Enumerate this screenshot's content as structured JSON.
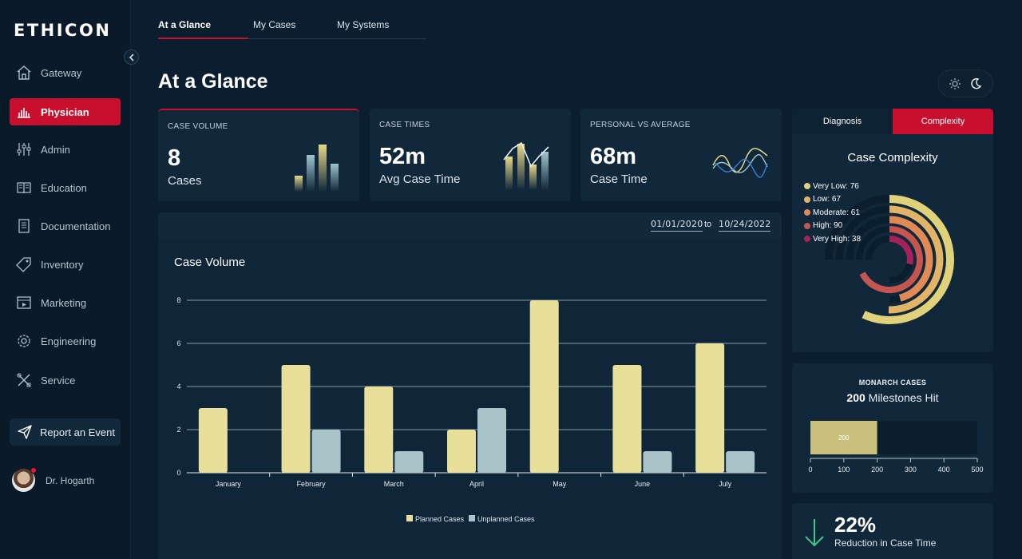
{
  "brand": "ETHICON",
  "sidebar": {
    "collapse_icon": "chevron-left-icon",
    "items": [
      {
        "label": "Gateway",
        "icon": "home-icon"
      },
      {
        "label": "Physician",
        "icon": "bar-chart-icon",
        "active": true
      },
      {
        "label": "Admin",
        "icon": "sliders-icon"
      },
      {
        "label": "Education",
        "icon": "book-icon"
      },
      {
        "label": "Documentation",
        "icon": "document-icon"
      },
      {
        "label": "Inventory",
        "icon": "tag-icon"
      },
      {
        "label": "Marketing",
        "icon": "video-icon"
      },
      {
        "label": "Engineering",
        "icon": "gear-icon"
      },
      {
        "label": "Service",
        "icon": "tools-icon"
      }
    ],
    "report_label": "Report an Event",
    "user_name": "Dr. Hogarth"
  },
  "tabs": [
    {
      "label": "At a Glance",
      "active": true
    },
    {
      "label": "My Cases"
    },
    {
      "label": "My Systems"
    }
  ],
  "page_title": "At a Glance",
  "theme_toggle": {
    "light_icon": "sun-icon",
    "dark_icon": "moon-icon",
    "selected": "dark"
  },
  "kpis": [
    {
      "label": "CASE VOLUME",
      "value": "8",
      "sub": "Cases"
    },
    {
      "label": "CASE TIMES",
      "value": "52m",
      "sub": "Avg Case Time"
    },
    {
      "label": "PERSONAL VS AVERAGE",
      "value": "68m",
      "sub": "Case Time"
    }
  ],
  "date_range": {
    "from": "01/01/2020",
    "separator": "to",
    "to": "10/24/2022"
  },
  "chart_data": {
    "type": "bar",
    "title": "Case Volume",
    "categories": [
      "January",
      "February",
      "March",
      "April",
      "May",
      "June",
      "July"
    ],
    "series": [
      {
        "name": "Planned Cases",
        "values": [
          3,
          5,
          4,
          2,
          8,
          5,
          6
        ],
        "color": "#e8e09a"
      },
      {
        "name": "Unplanned Cases",
        "values": [
          0,
          2,
          1,
          3,
          0,
          1,
          1
        ],
        "color": "#a9c4c9"
      }
    ],
    "yticks": [
      0,
      2,
      4,
      6,
      8
    ],
    "ylim": [
      0,
      8
    ],
    "grid": true,
    "legend": "bottom-center"
  },
  "complexity": {
    "tabs": [
      {
        "label": "Diagnosis"
      },
      {
        "label": "Complexity",
        "active": true
      }
    ],
    "title": "Case Complexity",
    "items": [
      {
        "label": "Very Low: 76",
        "value": 76,
        "color": "#e0d27a"
      },
      {
        "label": "Low: 67",
        "value": 67,
        "color": "#e2b468"
      },
      {
        "label": "Moderate: 61",
        "value": 61,
        "color": "#e08a55"
      },
      {
        "label": "High: 90",
        "value": 90,
        "color": "#c45550"
      },
      {
        "label": "Very High: 38",
        "value": 38,
        "color": "#a3225a"
      }
    ]
  },
  "monarch": {
    "label": "MONARCH CASES",
    "value": "200",
    "sub": "Milestones Hit",
    "bar_value": 200,
    "bar_label": "200",
    "axis_max": 500,
    "ticks": [
      "0",
      "100",
      "200",
      "300",
      "400",
      "500"
    ]
  },
  "reduction": {
    "value": "22%",
    "sub": "Reduction in Case Time",
    "icon": "arrow-down-icon"
  }
}
